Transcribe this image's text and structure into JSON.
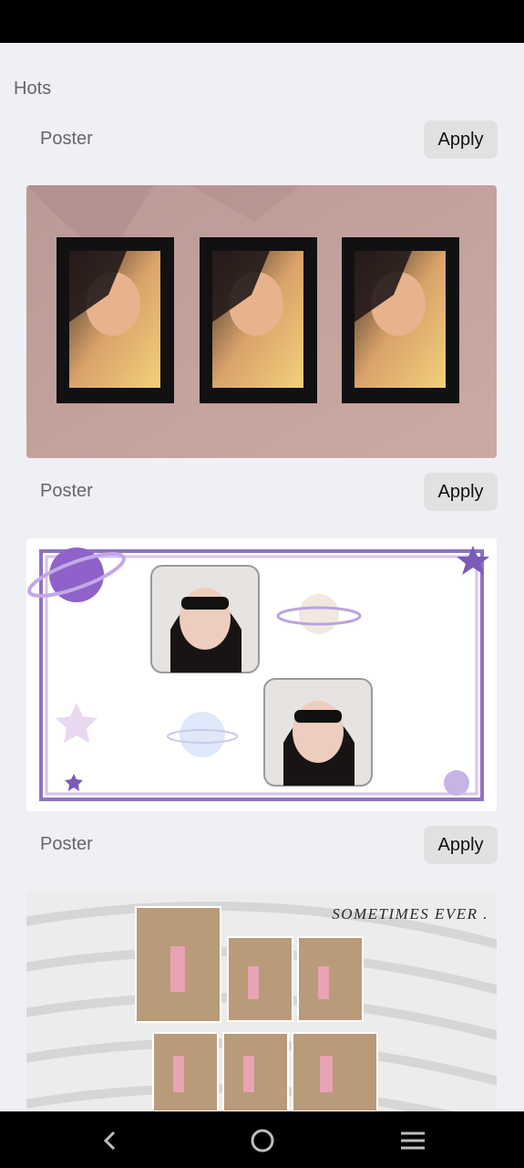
{
  "section": {
    "title": "Hots"
  },
  "cards": [
    {
      "label": "Poster",
      "apply_label": "Apply",
      "thumbnail": "frames-on-wall"
    },
    {
      "label": "Poster",
      "apply_label": "Apply",
      "thumbnail": "space-planets-frame"
    },
    {
      "label": "Poster",
      "apply_label": "Apply",
      "thumbnail": "photo-grid-waves",
      "caption": "SOMETIMES EVER ."
    }
  ],
  "nav": {
    "icons": [
      "back-icon",
      "home-icon",
      "menu-icon"
    ]
  },
  "colors": {
    "background": "#eff0f4",
    "button": "#e1e1e1",
    "label": "#666666",
    "wall": "#c9a6a0",
    "purple": "#8f72c2"
  }
}
